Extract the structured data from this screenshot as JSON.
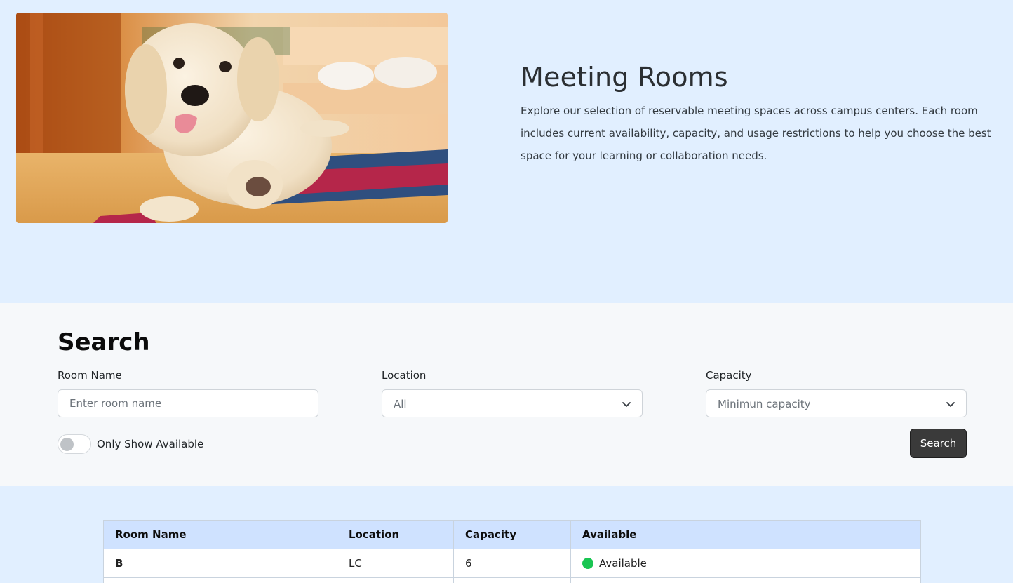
{
  "hero": {
    "title": "Meeting Rooms",
    "description": "Explore our selection of reservable meeting spaces across campus centers. Each room includes current availability, capacity, and usage restrictions to help you choose the best space for your learning or collaboration needs.",
    "image_icon": "puppy-photo"
  },
  "search": {
    "title": "Search",
    "room_name_label": "Room Name",
    "room_name_placeholder": "Enter room name",
    "location_label": "Location",
    "location_value": "All",
    "capacity_label": "Capacity",
    "capacity_value": "Minimun capacity",
    "toggle_label": "Only Show Available",
    "toggle_on": false,
    "button_label": "Search"
  },
  "table": {
    "headers": [
      "Room Name",
      "Location",
      "Capacity",
      "Available"
    ],
    "rows": [
      {
        "name": "B",
        "location": "LC",
        "capacity": "6",
        "available": "Available"
      }
    ]
  },
  "colors": {
    "hero_bg": "#e1efff",
    "search_bg": "#f6f8fa",
    "table_header_bg": "#cfe2ff",
    "available_dot": "#19c552",
    "button_bg": "#3a3a3a"
  }
}
